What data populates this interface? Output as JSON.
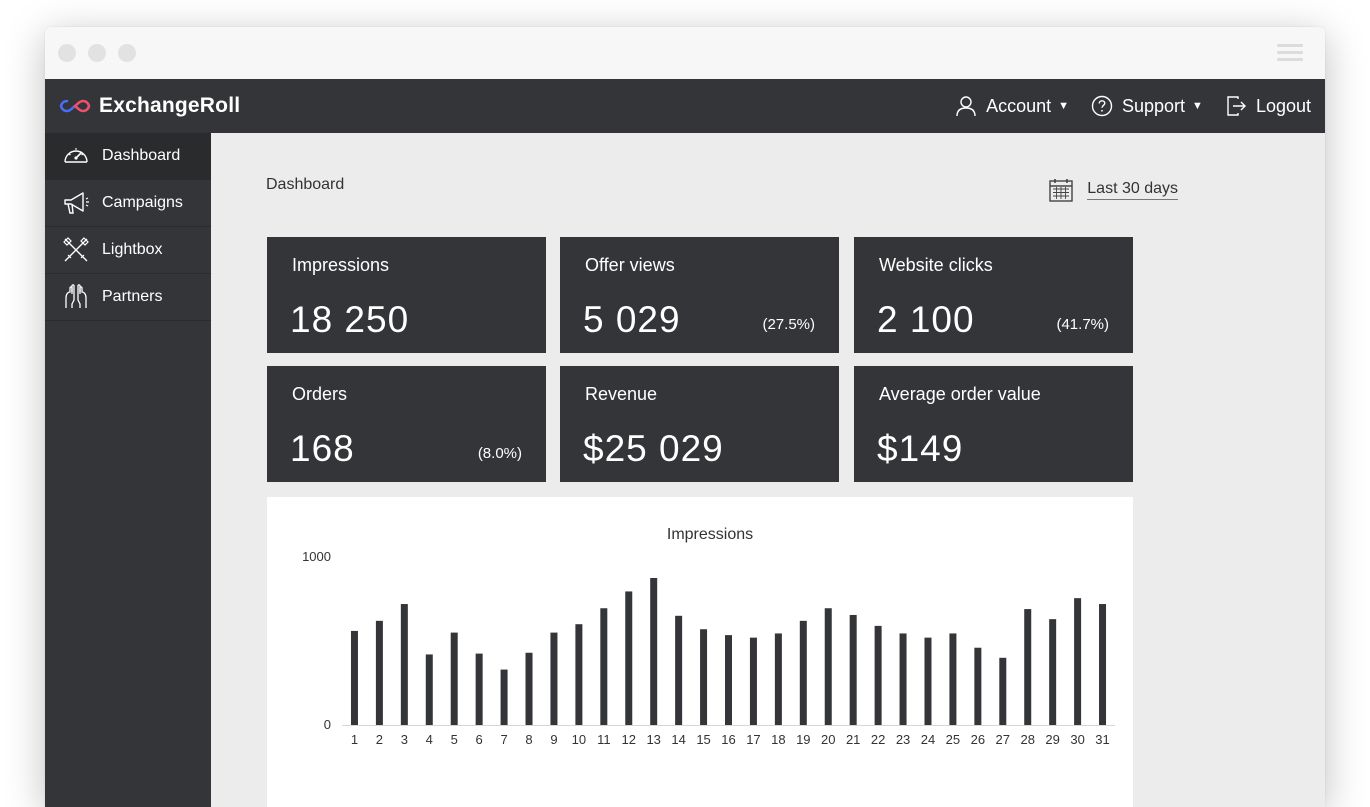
{
  "app": {
    "name": "ExchangeRoll"
  },
  "topnav": {
    "account": "Account",
    "support": "Support",
    "logout": "Logout"
  },
  "sidebar": {
    "items": [
      {
        "label": "Dashboard",
        "icon": "speedometer-icon"
      },
      {
        "label": "Campaigns",
        "icon": "megaphone-icon"
      },
      {
        "label": "Lightbox",
        "icon": "crossed-tools-icon"
      },
      {
        "label": "Partners",
        "icon": "hands-icon"
      }
    ]
  },
  "main": {
    "breadcrumb": "Dashboard",
    "date_range": "Last 30 days"
  },
  "cards": [
    {
      "label": "Impressions",
      "value": "18 250",
      "pct": ""
    },
    {
      "label": "Offer views",
      "value": "5 029",
      "pct": "(27.5%)"
    },
    {
      "label": "Website clicks",
      "value": "2 100",
      "pct": "(41.7%)"
    },
    {
      "label": "Orders",
      "value": "168",
      "pct": "(8.0%)"
    },
    {
      "label": "Revenue",
      "value": "$25 029",
      "pct": ""
    },
    {
      "label": "Average order value",
      "value": "$149",
      "pct": ""
    }
  ],
  "colors": {
    "panel": "#333538",
    "accent_logo_left": "#4a6cf7",
    "accent_logo_right": "#f0506e"
  },
  "chart_data": {
    "type": "bar",
    "title": "Impressions",
    "xlabel": "",
    "ylabel": "",
    "ylim": [
      0,
      1000
    ],
    "yticks": [
      0,
      1000
    ],
    "categories": [
      "1",
      "2",
      "3",
      "4",
      "5",
      "6",
      "7",
      "8",
      "9",
      "10",
      "11",
      "12",
      "13",
      "14",
      "15",
      "16",
      "17",
      "18",
      "19",
      "20",
      "21",
      "22",
      "23",
      "24",
      "25",
      "26",
      "27",
      "28",
      "29",
      "30",
      "31"
    ],
    "values": [
      560,
      620,
      720,
      420,
      550,
      425,
      330,
      430,
      550,
      600,
      695,
      795,
      875,
      650,
      570,
      535,
      520,
      545,
      620,
      695,
      655,
      590,
      545,
      520,
      545,
      460,
      400,
      690,
      630,
      755,
      720
    ],
    "grid": false,
    "legend": "none"
  }
}
